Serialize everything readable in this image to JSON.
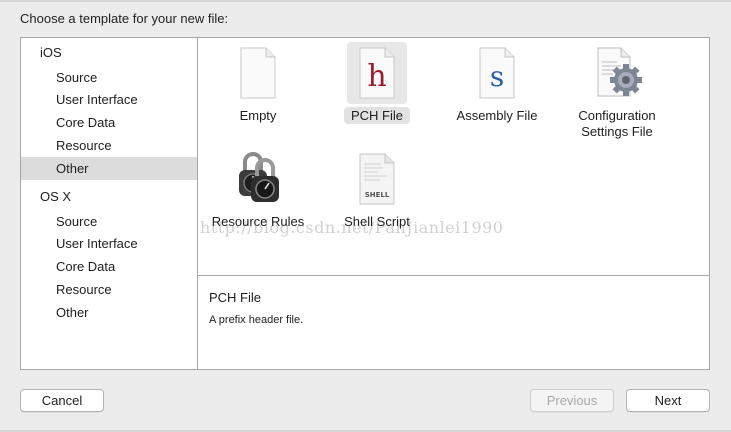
{
  "dialog": {
    "prompt": "Choose a template for your new file:"
  },
  "sidebar": {
    "groups": [
      {
        "label": "iOS",
        "items": [
          "Source",
          "User Interface",
          "Core Data",
          "Resource",
          "Other"
        ]
      },
      {
        "label": "OS X",
        "items": [
          "Source",
          "User Interface",
          "Core Data",
          "Resource",
          "Other"
        ]
      }
    ],
    "selected": "iOS / Other"
  },
  "templates": [
    {
      "label": "Empty",
      "icon": "empty-file-icon"
    },
    {
      "label": "PCH File",
      "icon": "pch-file-icon",
      "glyph": "h",
      "glyph_color": "#9b1b30",
      "selected": true
    },
    {
      "label": "Assembly File",
      "icon": "assembly-file-icon",
      "glyph": "s",
      "glyph_color": "#2a5fa8"
    },
    {
      "label_line1": "Configuration",
      "label_line2": "Settings File",
      "icon": "configuration-settings-file-icon"
    },
    {
      "label": "Resource Rules",
      "icon": "resource-rules-icon"
    },
    {
      "label": "Shell Script",
      "icon": "shell-script-icon",
      "glyph": "SHELL"
    }
  ],
  "detail": {
    "title": "PCH File",
    "description": "A prefix header file."
  },
  "watermark": "http://blog.csdn.net/PanJianlei1990",
  "buttons": {
    "cancel": "Cancel",
    "previous": "Previous",
    "next": "Next"
  },
  "colors": {
    "selection": "#dcdcdc",
    "pch_glyph": "#9b1b30",
    "asm_glyph": "#2a5fa8"
  }
}
